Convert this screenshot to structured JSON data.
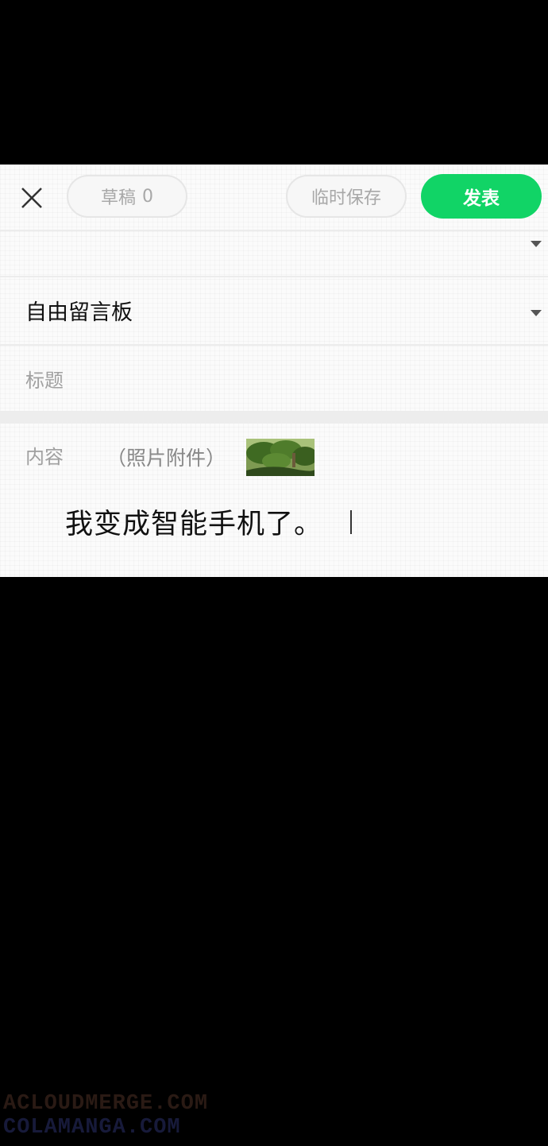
{
  "header": {
    "draft_label": "草稿",
    "draft_count": "0",
    "temp_save_label": "临时保存",
    "publish_label": "发表"
  },
  "form": {
    "board_name": "自由留言板",
    "title_placeholder": "标题",
    "content_label": "内容",
    "attachment_label": "（照片附件）",
    "content_text": "我变成智能手机了。"
  },
  "watermark": {
    "line1": "ACLOUDMERGE.COM",
    "line2": "COLAMANGA.COM"
  },
  "colors": {
    "accent_green": "#11d466",
    "background": "#000000",
    "panel": "#fbfbfb"
  },
  "icons": [
    "close-icon",
    "dropdown-caret-icon"
  ]
}
